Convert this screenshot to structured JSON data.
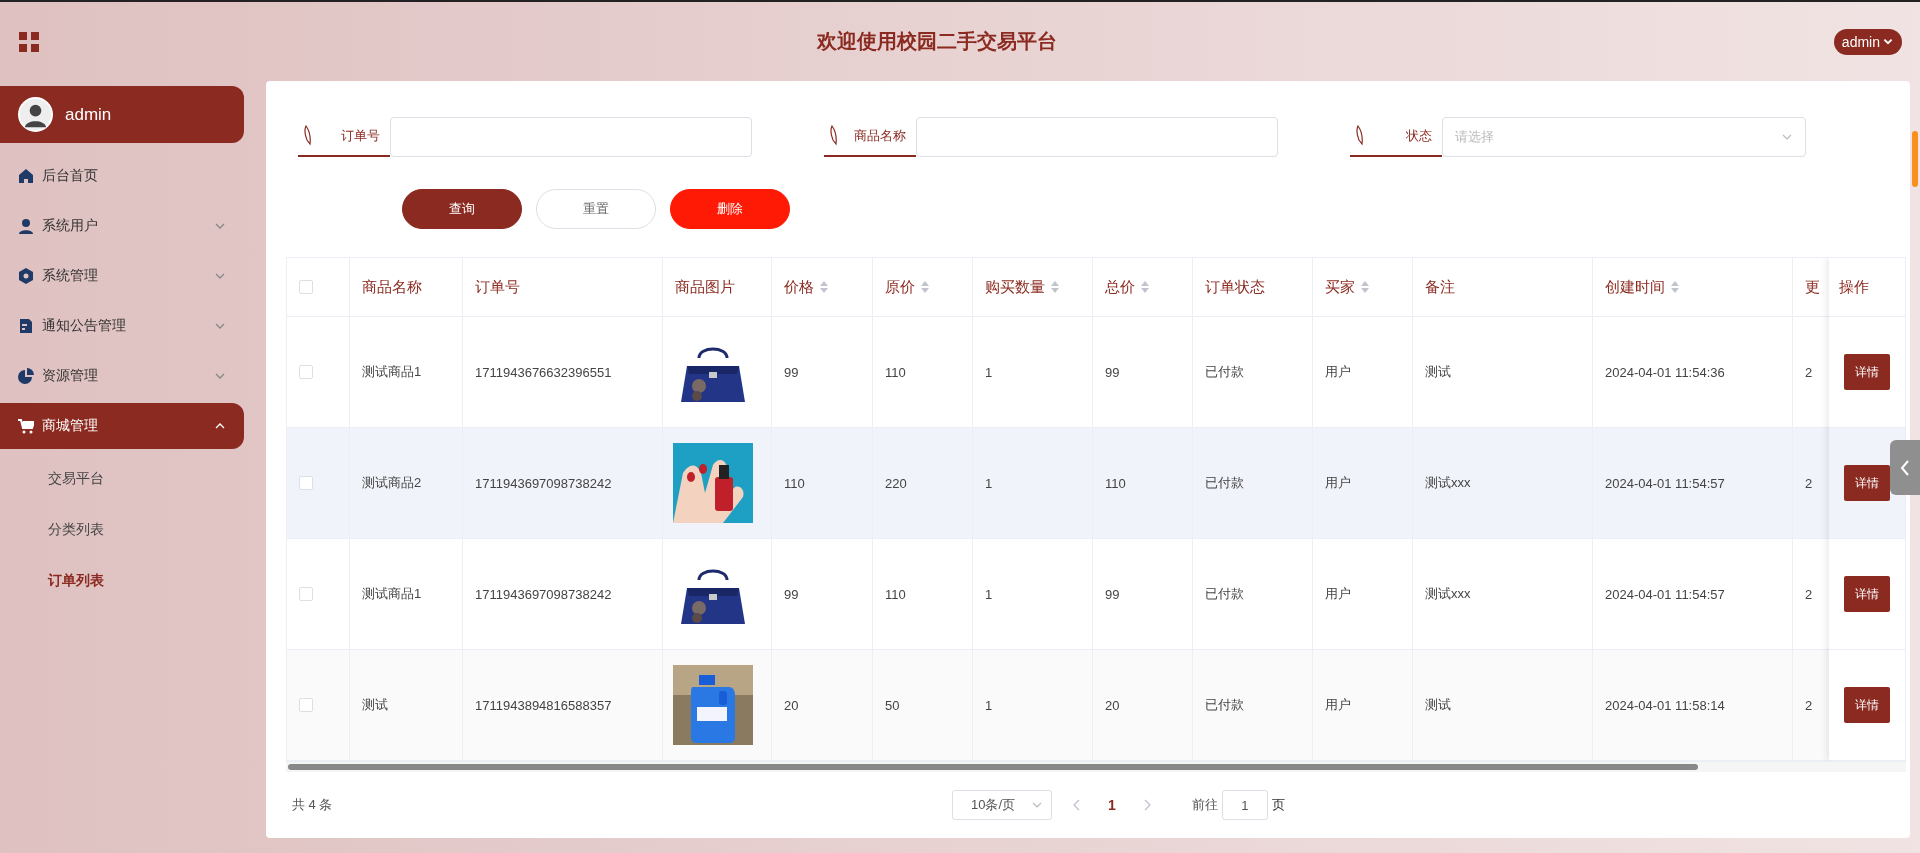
{
  "header": {
    "title": "欢迎使用校园二手交易平台",
    "user_menu": "admin"
  },
  "sidebar": {
    "user": "admin",
    "items": [
      {
        "label": "后台首页",
        "kind": "link"
      },
      {
        "label": "系统用户",
        "kind": "group",
        "expanded": false
      },
      {
        "label": "系统管理",
        "kind": "group",
        "expanded": false
      },
      {
        "label": "通知公告管理",
        "kind": "group",
        "expanded": false
      },
      {
        "label": "资源管理",
        "kind": "group",
        "expanded": false
      },
      {
        "label": "商城管理",
        "kind": "group",
        "expanded": true,
        "children": [
          {
            "label": "交易平台",
            "selected": false
          },
          {
            "label": "分类列表",
            "selected": false
          },
          {
            "label": "订单列表",
            "selected": true
          }
        ]
      }
    ]
  },
  "filters": [
    {
      "label": "订单号",
      "kind": "text"
    },
    {
      "label": "商品名称",
      "kind": "text"
    },
    {
      "label": "状态",
      "kind": "select",
      "placeholder": "请选择"
    }
  ],
  "buttons": [
    {
      "label": "查询",
      "kind": "primary"
    },
    {
      "label": "重置",
      "kind": "plain"
    },
    {
      "label": "删除",
      "kind": "danger"
    }
  ],
  "table": {
    "columns": [
      {
        "label": "商品名称",
        "sortable": false
      },
      {
        "label": "订单号",
        "sortable": false
      },
      {
        "label": "商品图片",
        "sortable": false
      },
      {
        "label": "价格",
        "sortable": true
      },
      {
        "label": "原价",
        "sortable": true
      },
      {
        "label": "购买数量",
        "sortable": true
      },
      {
        "label": "总价",
        "sortable": true
      },
      {
        "label": "订单状态",
        "sortable": false
      },
      {
        "label": "买家",
        "sortable": true
      },
      {
        "label": "备注",
        "sortable": false
      },
      {
        "label": "创建时间",
        "sortable": true
      },
      {
        "label": "更",
        "sortable": false
      }
    ],
    "action_header": "操作",
    "all_checked": false,
    "rows": [
      {
        "checked": false,
        "highlighted": false,
        "cells": [
          "测试商品1",
          "1711943676632396551",
          {
            "kind": "picture"
          },
          "99",
          "110",
          "1",
          "99",
          "已付款",
          "用户",
          "测试",
          "2024-04-01 11:54:36",
          "2"
        ],
        "action": "详情"
      },
      {
        "checked": false,
        "highlighted": true,
        "cells": [
          "测试商品2",
          "1711943697098738242",
          {
            "kind": "picture"
          },
          "110",
          "220",
          "1",
          "110",
          "已付款",
          "用户",
          "测试xxx",
          "2024-04-01 11:54:57",
          "2"
        ],
        "action": "详情"
      },
      {
        "checked": false,
        "highlighted": false,
        "cells": [
          "测试商品1",
          "1711943697098738242",
          {
            "kind": "picture"
          },
          "99",
          "110",
          "1",
          "99",
          "已付款",
          "用户",
          "测试xxx",
          "2024-04-01 11:54:57",
          "2"
        ],
        "action": "详情"
      },
      {
        "checked": false,
        "highlighted": false,
        "cells": [
          "测试",
          "1711943894816588357",
          {
            "kind": "picture"
          },
          "20",
          "50",
          "1",
          "20",
          "已付款",
          "用户",
          "测试",
          "2024-04-01 11:58:14",
          "2"
        ],
        "action": "详情"
      }
    ]
  },
  "pagination": {
    "total": "共 4 条",
    "page_size": "10条/页",
    "pages": [
      {
        "label": "1",
        "selected": true
      }
    ],
    "goto_label": "前往",
    "goto_value": "1",
    "goto_suffix": "页"
  }
}
